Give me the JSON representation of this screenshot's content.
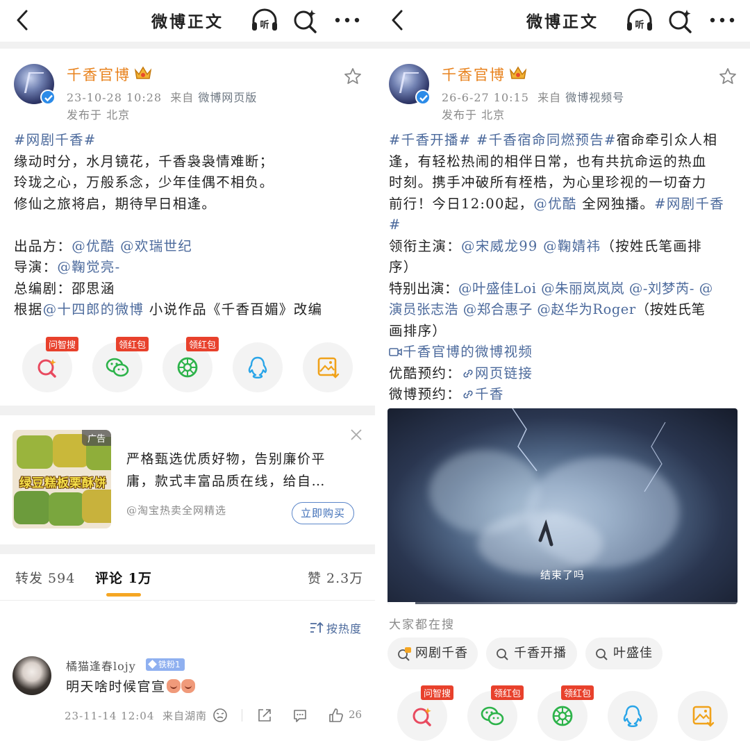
{
  "left": {
    "nav": {
      "title": "微博正文"
    },
    "post": {
      "author": "千香官博",
      "meta_time": "23-10-28 10:28",
      "meta_from": "来自",
      "meta_source": "微博网页版",
      "location": "发布于 北京",
      "hashtag": "#网剧千香#",
      "lines": [
        "缘动时分，水月镜花，千香袅袅情难断；",
        "玲珑之心，万般系念，少年佳偶不相负。",
        "修仙之旅将启，期待早日相逢。"
      ],
      "producer_label": "出品方：",
      "producers": "@优酷 @欢瑞世纪",
      "director_label": "导演：",
      "director": "@鞠觉亮-",
      "writer_line": "总编剧：邵思涵",
      "based_prefix": "根据",
      "based_link": "@十四郎的微博",
      "based_suffix": " 小说作品《千香百媚》改编"
    },
    "share": [
      {
        "icon": "ask-search-icon",
        "badge": "问智搜"
      },
      {
        "icon": "wechat-icon",
        "badge": "领红包"
      },
      {
        "icon": "moments-icon",
        "badge": "领红包"
      },
      {
        "icon": "qq-icon",
        "badge": ""
      },
      {
        "icon": "save-image-icon",
        "badge": ""
      }
    ],
    "ad": {
      "tag": "广告",
      "image_text": "绿豆糕板栗酥饼",
      "text_line1": "严格甄选优质好物，告别廉价平",
      "text_line2": "庸，款式丰富品质在线，给自…",
      "source": "@淘宝热卖全网精选",
      "button": "立即购买"
    },
    "tabs": {
      "repost": "转发 594",
      "comment": "评论 1万",
      "like": "赞 2.3万"
    },
    "sort_label": "按热度",
    "comment": {
      "user": "橘猫逢春lojy",
      "badge": "铁粉1",
      "text": "明天啥时候官宣",
      "time": "23-11-14 12:04",
      "from": "来自湖南",
      "likes": "26"
    }
  },
  "right": {
    "nav": {
      "title": "微博正文"
    },
    "post": {
      "author": "千香官博",
      "meta_time": "26-6-27 10:15",
      "meta_from": "来自",
      "meta_source": "微博视频号",
      "location": "发布于 北京",
      "l1_tag1": "#千香开播#",
      "l1_tag2": " #千香宿命同燃预告#",
      "l1_text": "宿命牵引众人相",
      "l2": "逢，有轻松热闹的相伴日常，也有共抗命运的热血",
      "l3": "时刻。携手冲破所有桎梏，为心里珍视的一切奋力",
      "l4_a": "前行！今日12:00起，",
      "l4_link": "@优酷",
      "l4_b": " 全网独播。",
      "l4_tag": "#网剧千香",
      "l5_tag": "#",
      "lead_label": "领衔主演：",
      "lead_links": "@宋威龙99 @鞠婧祎",
      "lead_suffix": "（按姓氏笔画排",
      "lead_cont": "序）",
      "special_label": "特别出演：",
      "special_l1": "@叶盛佳Loi @朱丽岚岚岚 @-刘梦芮- @",
      "special_l2": "演员张志浩 @郑合惠子 @赵华为Roger",
      "special_l2_suffix": "（按姓氏笔",
      "special_l3": "画排序）",
      "video_link": "千香官博的微博视频",
      "youku_label": "优酷预约：",
      "youku_link": "网页链接",
      "weibo_label": "微博预约：",
      "weibo_link": "千香"
    },
    "video": {
      "subtitle": "结束了吗",
      "progress": 0.08
    },
    "search": {
      "title": "大家都在搜",
      "chips": [
        "网剧千香",
        "千香开播",
        "叶盛佳"
      ]
    },
    "share": [
      {
        "icon": "ask-search-icon",
        "badge": "问智搜"
      },
      {
        "icon": "wechat-icon",
        "badge": "领红包"
      },
      {
        "icon": "moments-icon",
        "badge": "领红包"
      },
      {
        "icon": "qq-icon",
        "badge": ""
      },
      {
        "icon": "save-image-icon",
        "badge": ""
      }
    ]
  },
  "colors": {
    "accent_orange": "#e8821d",
    "link_blue": "#4c6a9c",
    "badge_red": "#e8412c",
    "tab_underline": "#f5a623"
  }
}
